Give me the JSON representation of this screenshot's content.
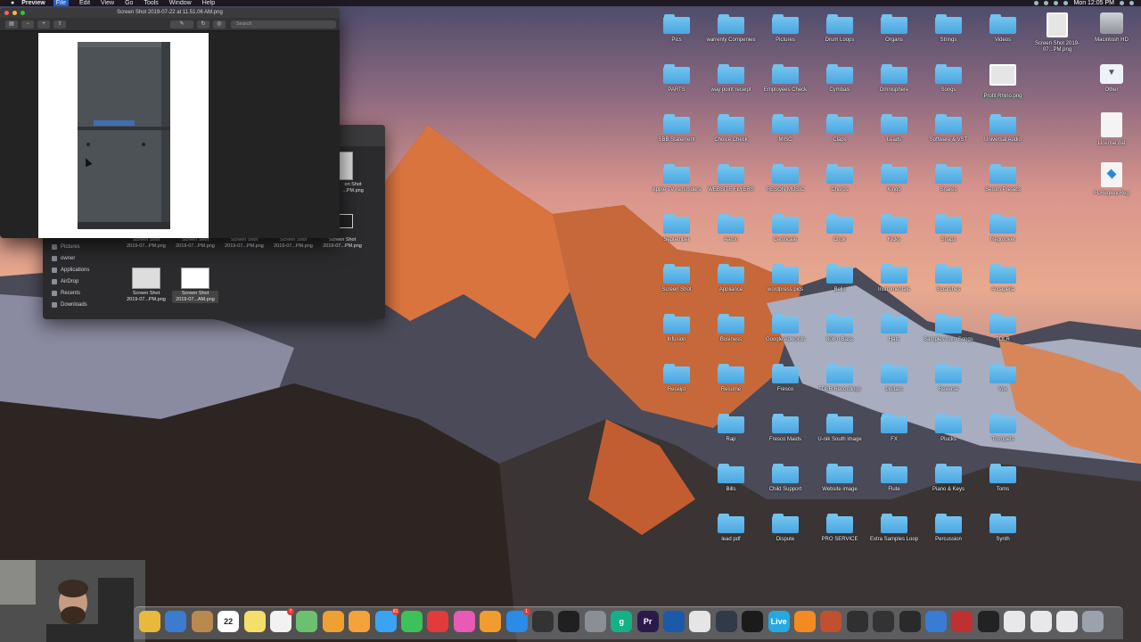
{
  "menubar": {
    "app": "Preview",
    "items": [
      "File",
      "Edit",
      "View",
      "Go",
      "Tools",
      "Window",
      "Help"
    ],
    "clock": "Mon 12:05 PM"
  },
  "preview_window": {
    "title": "Screen Shot 2019-07-22 at 11.51.06 AM.png",
    "search_placeholder": "Search"
  },
  "finder_window": {
    "sidebar": [
      {
        "label": "Pictures",
        "icon": "pictures-icon"
      },
      {
        "label": "owner",
        "icon": "home-icon"
      },
      {
        "label": "Applications",
        "icon": "applications-icon"
      },
      {
        "label": "AirDrop",
        "icon": "airdrop-icon"
      },
      {
        "label": "Recents",
        "icon": "recents-icon"
      },
      {
        "label": "Downloads",
        "icon": "downloads-icon"
      }
    ],
    "file_row1": [
      "Screen Shot\n2019-07...PM.png",
      "Screen Shot\n2019-07...PM.png",
      "Screen Shot\n2019-07...PM.png",
      "Screen Shot\n2019-07...PM.png",
      "Screen Shot\n2019-07...PM.png"
    ],
    "file_row2": [
      "Screen Shot\n2019-07...PM.png",
      "Screen Shot\n2019-07...AM.png"
    ],
    "partial_file": "on Shot\n...PM.png"
  },
  "desktop": {
    "folders_grid": [
      [
        "Pics",
        "warrenty Compenies",
        "Pictures",
        "Drum Loops",
        "Organs",
        "Strings",
        "Videos"
      ],
      [
        "PARTS",
        "way point receipt",
        "Employees Check",
        "Cymbals",
        "Omnisphere",
        "Songs",
        "Profit Rhino.png"
      ],
      [
        "SBB Statement",
        "Choice Check",
        "MISC",
        "Claps",
        "Leads",
        "Software & VST",
        "Universal Audio"
      ],
      [
        "Apple TV remimders",
        "WEBSITE FLYERS",
        "RESON MUSIC",
        "Chords",
        "Kingo",
        "Snares",
        "Serum Presets"
      ],
      [
        "September",
        "Aaron",
        "Certificate",
        "Choir",
        "Kicks",
        "Snaps",
        "Regroover"
      ],
      [
        "Screen Shot",
        "Appliance",
        "wordpress pics",
        "Bells",
        "Instrumentals",
        "Scratches",
        "Accapella"
      ],
      [
        "Infusion",
        "Business",
        "Google Adwords",
        "808 n Bass",
        "Hats",
        "Samples from Songs",
        "TDLR"
      ],
      [
        "Receipt",
        "Resume",
        "Fresco",
        "TDLR Recordings",
        "Guitars",
        "Reverse",
        "Vox"
      ],
      [
        "",
        "Rap",
        "Fresco Maids",
        "U-nik South image",
        "FX",
        "Plucks",
        "Trumpets"
      ],
      [
        "",
        "Bills",
        "Child Support",
        "Website image",
        "Flute",
        "Piano & Keys",
        "Toms"
      ],
      [
        "",
        "lead pdf",
        "Dispute",
        "PRO SERVICE",
        "Extra Samples Loop",
        "Percussion",
        "Synth"
      ]
    ],
    "right_column": [
      {
        "label": "Screen Shot 2019-07...PM.png",
        "icon": "image-file-icon"
      },
      {
        "label": "Macintosh HD",
        "icon": "hard-drive-icon"
      },
      {
        "label": "Other",
        "icon": "disk-image-icon"
      },
      {
        "label": "License.dat",
        "icon": "document-icon"
      },
      {
        "label": "FLRegkey.Reg",
        "icon": "reg-file-icon"
      }
    ]
  },
  "dock": {
    "items": [
      {
        "name": "chrome-icon",
        "color": "#e8b93a"
      },
      {
        "name": "preview-icon",
        "color": "#3b7bd0"
      },
      {
        "name": "contacts-icon",
        "color": "#b98a4e"
      },
      {
        "name": "calendar-icon",
        "color": "#ffffff",
        "text": "22"
      },
      {
        "name": "notes-icon",
        "color": "#f6de6a"
      },
      {
        "name": "reminders-icon",
        "color": "#f2f2f2",
        "badge": "7"
      },
      {
        "name": "maps-icon",
        "color": "#6cc070"
      },
      {
        "name": "photos-icon",
        "color": "#f0a030"
      },
      {
        "name": "pages-icon",
        "color": "#f4a23a"
      },
      {
        "name": "messages-icon",
        "color": "#3aa3f2",
        "badge": "81"
      },
      {
        "name": "facetime-icon",
        "color": "#3cc259"
      },
      {
        "name": "news-icon",
        "color": "#e23b3b"
      },
      {
        "name": "itunes-icon",
        "color": "#e85ab4"
      },
      {
        "name": "ibooks-icon",
        "color": "#f29b2e"
      },
      {
        "name": "app-store-icon",
        "color": "#2b8be8",
        "badge": "1"
      },
      {
        "name": "final-cut-icon",
        "color": "#333333"
      },
      {
        "name": "piano-icon",
        "color": "#202020"
      },
      {
        "name": "system-preferences-icon",
        "color": "#8a8f96"
      },
      {
        "name": "grammarly-icon",
        "color": "#16b086",
        "text": "g"
      },
      {
        "name": "premiere-icon",
        "color": "#2a1a4a",
        "text": "Pr"
      },
      {
        "name": "browser-icon",
        "color": "#1a5aa8"
      },
      {
        "name": "vlc-icon",
        "color": "#e5e5e5"
      },
      {
        "name": "davinci-icon",
        "color": "#303a48"
      },
      {
        "name": "obs-icon",
        "color": "#1b1b1b"
      },
      {
        "name": "ableton-live-icon",
        "color": "#26a8e0",
        "text": "Live"
      },
      {
        "name": "fl-studio-icon",
        "color": "#f28b22"
      },
      {
        "name": "reason-icon",
        "color": "#c05030"
      },
      {
        "name": "native-access-icon",
        "color": "#303030"
      },
      {
        "name": "kontakt-icon",
        "color": "#333333"
      },
      {
        "name": "dropbox-icon",
        "color": "#2a2a2a"
      },
      {
        "name": "finder-icon",
        "color": "#3a7bd5"
      },
      {
        "name": "acrobat-icon",
        "color": "#c03030"
      },
      {
        "name": "logic-icon",
        "color": "#222222"
      },
      {
        "name": "document-1-icon",
        "color": "#e8e8ea"
      },
      {
        "name": "document-2-icon",
        "color": "#e8e8ea"
      },
      {
        "name": "document-3-icon",
        "color": "#e8e8ea"
      },
      {
        "name": "trash-icon",
        "color": "#9ba2ab"
      }
    ]
  }
}
